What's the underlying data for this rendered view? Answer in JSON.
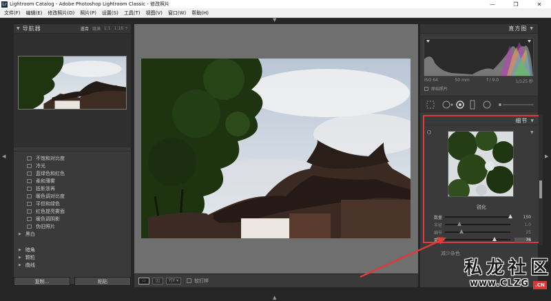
{
  "window": {
    "app_icon": "Lr",
    "title": "Lightroom Catalog - Adobe Photoshop Lightroom Classic - 修改照片",
    "minimize": "—",
    "maximize": "❐",
    "close": "✕"
  },
  "menu": [
    "文件(F)",
    "编辑(E)",
    "修改照片(D)",
    "照片(P)",
    "设置(S)",
    "工具(T)",
    "视图(V)",
    "窗口(W)",
    "帮助(H)"
  ],
  "navigator": {
    "title": "导航器",
    "zoom_fit": "适合",
    "zoom_fill": "填满",
    "zoom_1": "1:1",
    "zoom_custom": "1:16 ÷"
  },
  "presets": {
    "items": [
      "不饱和对比度",
      "冷光",
      "蓝绿色和红色",
      "柔和薄雾",
      "抵影浙再",
      "暖色调对比度",
      "平但和绿色",
      "红色提亮雾面",
      "暖色调阴影",
      "伪旧照片"
    ],
    "groups": [
      "黑白",
      "暗角",
      "颗粒",
      "曲线"
    ]
  },
  "left_buttons": {
    "copy": "复制...",
    "paste": "粘贴"
  },
  "toolbar": {
    "view_before_after": "Y|Y ▾",
    "soft_proof": "软打样"
  },
  "histogram": {
    "title": "直方图",
    "iso": "ISO 64",
    "focal": "50 mm",
    "aperture": "f / 9.0",
    "shutter": "1/125 秒",
    "original_photo": "原始照片"
  },
  "detail": {
    "title": "细节",
    "warn_icon": "▼",
    "sharpen_title": "锐化",
    "sliders": [
      {
        "label": "数量",
        "value": "150",
        "pct": 1.0
      },
      {
        "label": "半径",
        "value": "1.0",
        "pct": 0.22
      },
      {
        "label": "细节",
        "value": "25",
        "pct": 0.25
      },
      {
        "label": "蒙版",
        "value": "76",
        "pct": 0.76
      }
    ]
  },
  "noise": {
    "label": "减少杂色"
  },
  "watermark": {
    "title": "私龙社区",
    "url": "www.CLZG",
    "cn": ".CN"
  },
  "colors": {
    "highlight_border": "#e0393e",
    "annotation_arrow": "#e23a3a"
  }
}
